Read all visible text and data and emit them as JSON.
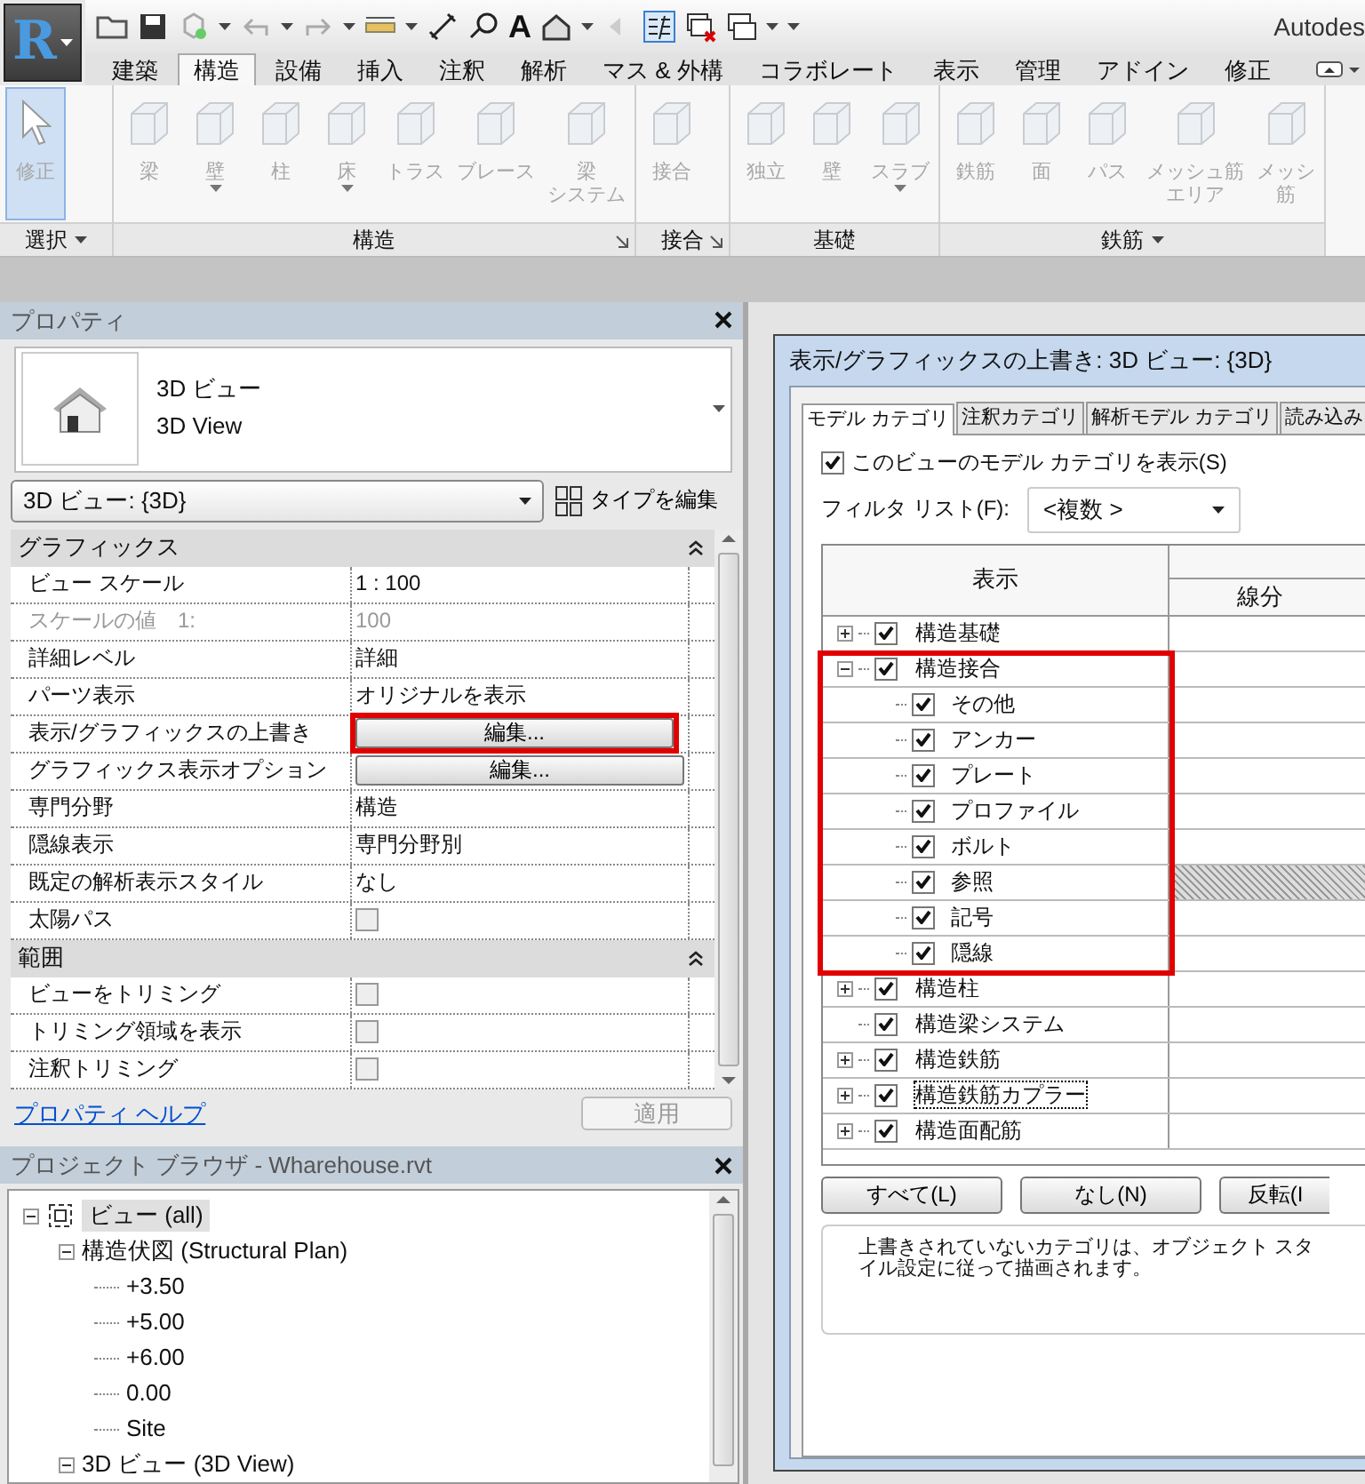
{
  "app": {
    "logo": "R",
    "title": "Autodes",
    "text_tool": "A"
  },
  "ribbon_tabs": [
    {
      "label": "建築",
      "selected": false
    },
    {
      "label": "構造",
      "selected": true
    },
    {
      "label": "設備",
      "selected": false
    },
    {
      "label": "挿入",
      "selected": false
    },
    {
      "label": "注釈",
      "selected": false
    },
    {
      "label": "解析",
      "selected": false
    },
    {
      "label": "マス & 外構",
      "selected": false
    },
    {
      "label": "コラボレート",
      "selected": false
    },
    {
      "label": "表示",
      "selected": false
    },
    {
      "label": "管理",
      "selected": false
    },
    {
      "label": "アドイン",
      "selected": false
    },
    {
      "label": "修正",
      "selected": false
    }
  ],
  "ribbon_panels": [
    {
      "label": "選択",
      "menu": true,
      "launcher": false,
      "tools": [
        {
          "lines": [
            "修正"
          ],
          "menu": false,
          "selected": true
        }
      ]
    },
    {
      "label": "構造",
      "menu": false,
      "launcher": true,
      "tools": [
        {
          "lines": [
            "梁"
          ],
          "menu": false,
          "selected": false
        },
        {
          "lines": [
            "壁"
          ],
          "menu": true,
          "selected": false
        },
        {
          "lines": [
            "柱"
          ],
          "menu": false,
          "selected": false
        },
        {
          "lines": [
            "床"
          ],
          "menu": true,
          "selected": false
        },
        {
          "lines": [
            "トラス"
          ],
          "menu": false,
          "selected": false
        },
        {
          "lines": [
            "ブレース"
          ],
          "menu": false,
          "selected": false
        },
        {
          "lines": [
            "梁",
            "システム"
          ],
          "menu": false,
          "selected": false
        }
      ]
    },
    {
      "label": "接合",
      "menu": false,
      "launcher": true,
      "tools": [
        {
          "lines": [
            "接合"
          ],
          "menu": false,
          "selected": false
        }
      ]
    },
    {
      "label": "基礎",
      "menu": false,
      "launcher": false,
      "tools": [
        {
          "lines": [
            "独立"
          ],
          "menu": false,
          "selected": false
        },
        {
          "lines": [
            "壁"
          ],
          "menu": false,
          "selected": false
        },
        {
          "lines": [
            "スラブ"
          ],
          "menu": true,
          "selected": false
        }
      ]
    },
    {
      "label": "鉄筋",
      "menu": true,
      "launcher": false,
      "tools": [
        {
          "lines": [
            "鉄筋"
          ],
          "menu": false,
          "selected": false
        },
        {
          "lines": [
            "面"
          ],
          "menu": false,
          "selected": false
        },
        {
          "lines": [
            "パス"
          ],
          "menu": false,
          "selected": false
        },
        {
          "lines": [
            "メッシュ筋",
            "エリア"
          ],
          "menu": false,
          "selected": false
        },
        {
          "lines": [
            "メッシ",
            "筋"
          ],
          "menu": false,
          "selected": false
        }
      ]
    }
  ],
  "properties": {
    "title": "プロパティ",
    "type_lines": [
      "3D ビュー",
      "3D View"
    ],
    "view_selector": "3D ビュー: {3D}",
    "edit_type": "タイプを編集",
    "groups": [
      {
        "label": "グラフィックス",
        "rows": [
          {
            "kind": "text",
            "name": "ビュー スケール",
            "value": "1 : 100",
            "disabled": false,
            "highlighted": false
          },
          {
            "kind": "text",
            "name": "スケールの値　1:",
            "value": "100",
            "disabled": true,
            "highlighted": false
          },
          {
            "kind": "text",
            "name": "詳細レベル",
            "value": "詳細",
            "disabled": false,
            "highlighted": false
          },
          {
            "kind": "text",
            "name": "パーツ表示",
            "value": "オリジナルを表示",
            "disabled": false,
            "highlighted": false
          },
          {
            "kind": "button",
            "name": "表示/グラフィックスの上書き",
            "value": "編集...",
            "disabled": false,
            "highlighted": true
          },
          {
            "kind": "button",
            "name": "グラフィックス表示オプション",
            "value": "編集...",
            "disabled": false,
            "highlighted": false
          },
          {
            "kind": "text",
            "name": "専門分野",
            "value": "構造",
            "disabled": false,
            "highlighted": false
          },
          {
            "kind": "text",
            "name": "隠線表示",
            "value": "専門分野別",
            "disabled": false,
            "highlighted": false
          },
          {
            "kind": "text",
            "name": "既定の解析表示スタイル",
            "value": "なし",
            "disabled": false,
            "highlighted": false
          },
          {
            "kind": "check",
            "name": "太陽パス",
            "checked": false,
            "disabled": false,
            "highlighted": false
          }
        ]
      },
      {
        "label": "範囲",
        "rows": [
          {
            "kind": "check",
            "name": "ビューをトリミング",
            "checked": false,
            "disabled": false,
            "highlighted": false
          },
          {
            "kind": "check",
            "name": "トリミング領域を表示",
            "checked": false,
            "disabled": false,
            "highlighted": false
          },
          {
            "kind": "check",
            "name": "注釈トリミング",
            "checked": false,
            "disabled": false,
            "highlighted": false
          }
        ]
      }
    ],
    "help": "プロパティ ヘルプ",
    "apply": "適用"
  },
  "project_browser": {
    "title": "プロジェクト ブラウザ - Wharehouse.rvt",
    "tree": [
      {
        "label": "ビュー (all)",
        "expanded": true,
        "selected": true,
        "children": [
          {
            "label": "構造伏図 (Structural Plan)",
            "expanded": true,
            "selected": false,
            "children": [
              {
                "label": "+3.50"
              },
              {
                "label": "+5.00"
              },
              {
                "label": "+6.00"
              },
              {
                "label": "0.00"
              },
              {
                "label": "Site"
              }
            ]
          },
          {
            "label": "3D ビュー (3D View)",
            "expanded": true,
            "selected": false
          }
        ]
      }
    ]
  },
  "dialog": {
    "title": "表示/グラフィックスの上書き: 3D ビュー: {3D}",
    "tabs": [
      {
        "label": "モデル カテゴリ",
        "selected": true
      },
      {
        "label": "注釈カテゴリ",
        "selected": false
      },
      {
        "label": "解析モデル カテゴリ",
        "selected": false
      },
      {
        "label": "読み込み",
        "selected": false
      }
    ],
    "show_categories": {
      "label": "このビューのモデル カテゴリを表示(S)",
      "checked": true
    },
    "filter": {
      "label": "フィルタ リスト(F):",
      "value": "<複数 >"
    },
    "columns": [
      "表示",
      "線分"
    ],
    "categories": [
      {
        "label": "構造基礎",
        "checked": true,
        "expandable": true,
        "expanded": false,
        "highlighted": false,
        "focused": false,
        "shaded": false
      },
      {
        "label": "構造接合",
        "checked": true,
        "expandable": true,
        "expanded": true,
        "highlighted": true,
        "focused": false,
        "shaded": false,
        "children": [
          {
            "label": "その他",
            "checked": true,
            "shaded": false
          },
          {
            "label": "アンカー",
            "checked": true,
            "shaded": false
          },
          {
            "label": "プレート",
            "checked": true,
            "shaded": false
          },
          {
            "label": "プロファイル",
            "checked": true,
            "shaded": false
          },
          {
            "label": "ボルト",
            "checked": true,
            "shaded": false
          },
          {
            "label": "参照",
            "checked": true,
            "shaded": true
          },
          {
            "label": "記号",
            "checked": true,
            "shaded": false
          },
          {
            "label": "隠線",
            "checked": true,
            "shaded": false
          }
        ]
      },
      {
        "label": "構造柱",
        "checked": true,
        "expandable": true,
        "expanded": false,
        "highlighted": false,
        "focused": false,
        "shaded": false
      },
      {
        "label": "構造梁システム",
        "checked": true,
        "expandable": false,
        "highlighted": false,
        "focused": false,
        "shaded": false
      },
      {
        "label": "構造鉄筋",
        "checked": true,
        "expandable": true,
        "expanded": false,
        "highlighted": false,
        "focused": false,
        "shaded": false
      },
      {
        "label": "構造鉄筋カプラー",
        "checked": true,
        "expandable": true,
        "expanded": false,
        "highlighted": false,
        "focused": true,
        "shaded": false
      },
      {
        "label": "構造面配筋",
        "checked": true,
        "expandable": true,
        "expanded": false,
        "highlighted": false,
        "focused": false,
        "shaded": false
      }
    ],
    "buttons": [
      "すべて(L)",
      "なし(N)",
      "反転(I"
    ],
    "note": "上書きされていないカテゴリは、オブジェクト スタイル設定に従って描画されます。"
  }
}
